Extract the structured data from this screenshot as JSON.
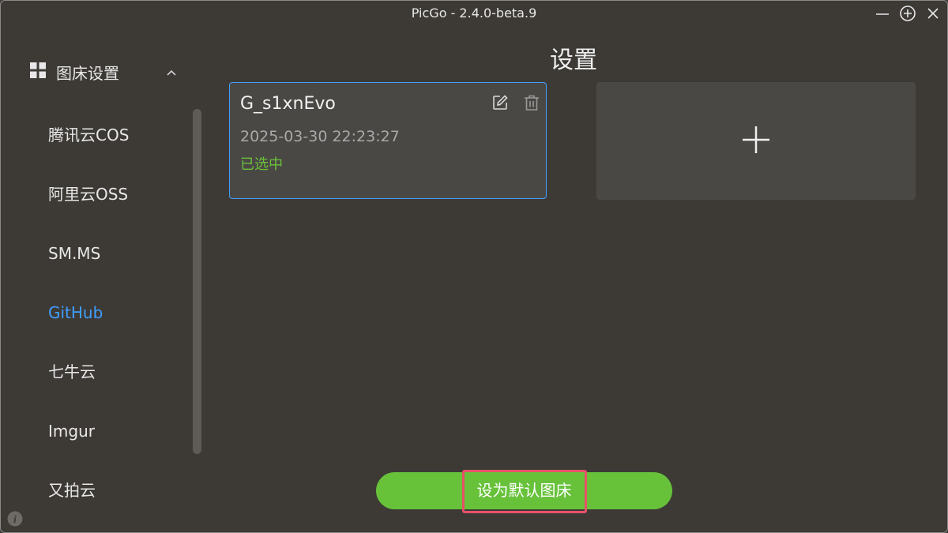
{
  "window": {
    "title": "PicGo - 2.4.0-beta.9"
  },
  "sidebar": {
    "menu_title": "图床设置",
    "items": [
      {
        "label": "腾讯云COS",
        "active": false
      },
      {
        "label": "阿里云OSS",
        "active": false
      },
      {
        "label": "SM.MS",
        "active": false
      },
      {
        "label": "GitHub",
        "active": true
      },
      {
        "label": "七牛云",
        "active": false
      },
      {
        "label": "Imgur",
        "active": false
      },
      {
        "label": "又拍云",
        "active": false
      }
    ]
  },
  "main": {
    "title": "设置",
    "config_card": {
      "name": "G_s1xnEvo",
      "time": "2025-03-30 22:23:27",
      "status": "已选中"
    },
    "default_button": "设为默认图床"
  },
  "colors": {
    "background": "#3d3a36",
    "card": "#4a4845",
    "accent_blue": "#409eff",
    "accent_green": "#67c23a",
    "selected_text": "#6ac13a",
    "highlight_red": "#e8506a"
  },
  "icons": [
    "grid-icon",
    "chevron-up-icon",
    "edit-icon",
    "trash-icon",
    "plus-icon",
    "info-icon",
    "minimize-icon",
    "maximize-icon",
    "close-icon"
  ]
}
